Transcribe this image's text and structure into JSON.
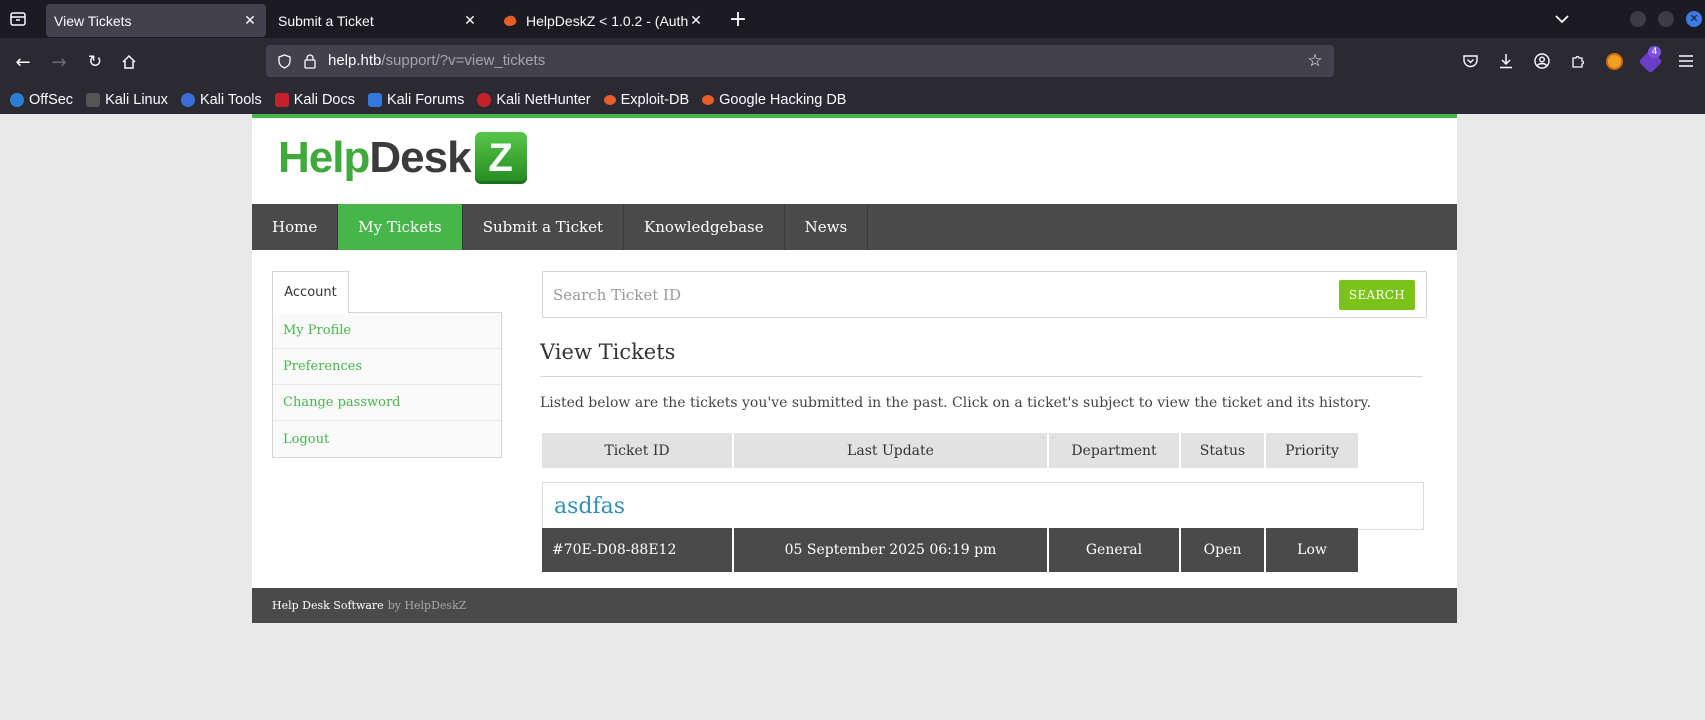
{
  "browser": {
    "tabs": [
      {
        "label": "View Tickets",
        "active": true
      },
      {
        "label": "Submit a Ticket",
        "active": false
      },
      {
        "label": "HelpDeskZ < 1.0.2 - (Auth",
        "active": false
      }
    ],
    "url_host": "help.htb",
    "url_path": "/support/?v=view_tickets",
    "extensions_badge": "4",
    "bookmarks": [
      {
        "label": "OffSec",
        "color": "#2a7fd4"
      },
      {
        "label": "Kali Linux",
        "color": "#222222"
      },
      {
        "label": "Kali Tools",
        "color": "#3b6fd4"
      },
      {
        "label": "Kali Docs",
        "color": "#c8202a"
      },
      {
        "label": "Kali Forums",
        "color": "#3478d8"
      },
      {
        "label": "Kali NetHunter",
        "color": "#c8202a"
      },
      {
        "label": "Exploit-DB",
        "color": "#e85d2a"
      },
      {
        "label": "Google Hacking DB",
        "color": "#e85d2a"
      }
    ]
  },
  "site": {
    "logo": {
      "help": "Help",
      "desk": "Desk",
      "z": "Z"
    },
    "accent_color": "#47b64a",
    "nav": [
      "Home",
      "My Tickets",
      "Submit a Ticket",
      "Knowledgebase",
      "News"
    ],
    "nav_active_index": 1,
    "sidebar": {
      "tab": "Account",
      "links": [
        "My Profile",
        "Preferences",
        "Change password",
        "Logout"
      ]
    },
    "search": {
      "placeholder": "Search Ticket ID",
      "button": "SEARCH"
    },
    "title": "View Tickets",
    "intro": "Listed below are the tickets you've submitted in the past. Click on a ticket's subject to view the ticket and its history.",
    "table": {
      "headers": [
        "Ticket ID",
        "Last Update",
        "Department",
        "Status",
        "Priority"
      ],
      "tickets": [
        {
          "subject": "asdfas",
          "id": "#70E-D08-88E12",
          "last_update": "05 September 2025 06:19 pm",
          "department": "General",
          "status": "Open",
          "priority": "Low"
        }
      ]
    },
    "footer": {
      "text": "Help Desk Software",
      "by": "by HelpDeskZ"
    }
  }
}
